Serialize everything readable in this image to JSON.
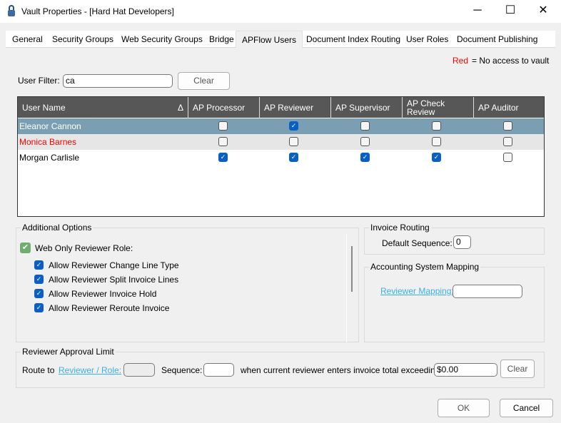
{
  "window": {
    "title": "Vault Properties - [Hard Hat Developers]",
    "minimize": "─",
    "maximize": "☐",
    "close": "✕"
  },
  "tabs": [
    {
      "label": "General"
    },
    {
      "label": "Security Groups"
    },
    {
      "label": "Web Security Groups"
    },
    {
      "label": "Bridge"
    },
    {
      "label": "APFlow Users",
      "active": true
    },
    {
      "label": "Document Index Routing"
    },
    {
      "label": "User Roles"
    },
    {
      "label": "Document Publishing"
    }
  ],
  "legend": {
    "red_label": "Red",
    "text": "= No access to vault",
    "red_color": "#ff0000"
  },
  "filter": {
    "label": "User Filter:",
    "value": "ca",
    "clear": "Clear"
  },
  "grid": {
    "columns": [
      "User Name",
      "AP Processor",
      "AP Reviewer",
      "AP Supervisor",
      "AP Check Review",
      "AP Auditor"
    ],
    "sort_indicator": "Δ",
    "rows": [
      {
        "name": "Eleanor Cannon",
        "selected": true,
        "no_access": false,
        "checks": [
          false,
          true,
          false,
          false,
          false
        ]
      },
      {
        "name": "Monica Barnes",
        "selected": false,
        "no_access": true,
        "checks": [
          false,
          false,
          false,
          false,
          false
        ]
      },
      {
        "name": "Morgan Carlisle",
        "selected": false,
        "no_access": false,
        "checks": [
          true,
          true,
          true,
          true,
          false
        ]
      }
    ]
  },
  "additional_options": {
    "title": "Additional Options",
    "web_only": {
      "label": "Web Only Reviewer Role:",
      "checked": true
    },
    "options": [
      {
        "label": "Allow Reviewer Change Line Type",
        "checked": true
      },
      {
        "label": "Allow Reviewer Split Invoice Lines",
        "checked": true
      },
      {
        "label": "Allow Reviewer Invoice Hold",
        "checked": true
      },
      {
        "label": "Allow Reviewer Reroute Invoice",
        "checked": true
      }
    ]
  },
  "invoice_routing": {
    "title": "Invoice Routing",
    "default_sequence_label": "Default Sequence:",
    "default_sequence": "0"
  },
  "accounting": {
    "title": "Accounting System Mapping",
    "reviewer_mapping": "Reviewer Mapping:",
    "value": ""
  },
  "approval": {
    "title": "Reviewer Approval Limit",
    "route_to": "Route to",
    "reviewer_role": "Reviewer / Role:",
    "sequence": "Sequence:",
    "when": "when current reviewer enters invoice total exceeding:",
    "amount": "$0.00",
    "clear": "Clear"
  },
  "footer": {
    "ok": "OK",
    "cancel": "Cancel"
  }
}
